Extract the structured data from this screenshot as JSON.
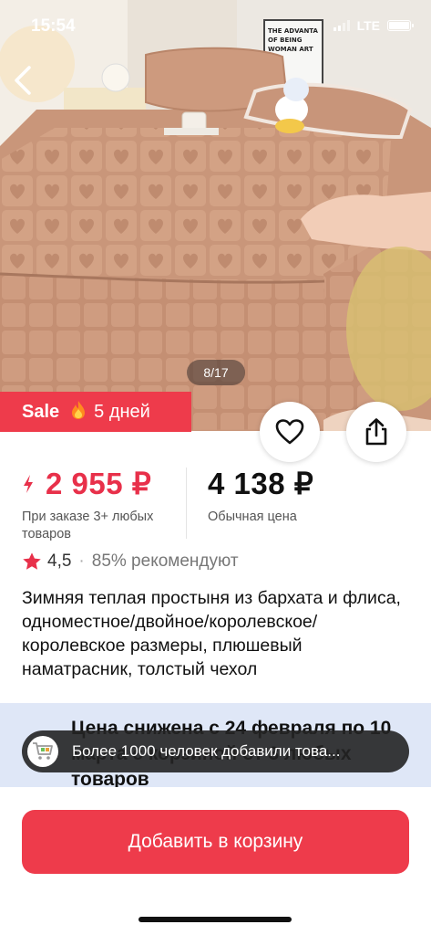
{
  "status_bar": {
    "time": "15:54",
    "network": "LTE"
  },
  "gallery": {
    "counter": "8/17",
    "poster_text": "THE ADVANTA OF BEING WOMAN ART"
  },
  "sale_badge": {
    "label": "Sale",
    "icon": "fire-icon",
    "days": "5 дней"
  },
  "price": {
    "sale_price": "2 955 ₽",
    "sale_note": "При заказе 3+ любых товаров",
    "regular_price": "4 138 ₽",
    "regular_note": "Обычная цена"
  },
  "rating": {
    "value": "4,5",
    "recommend": "85% рекомендуют"
  },
  "product": {
    "title": "Зимняя теплая простыня из бархата и флиса, одноместное/двойное/королевское/королевское размеры, плюшевый наматрасник, толстый чехол"
  },
  "promo": {
    "text": "Цена снижена с 24 февраля по 10 марта с корзиной от 3 любых товаров"
  },
  "toast": {
    "text": "Более 1000 человек добавили това..."
  },
  "cta": {
    "label": "Добавить в корзину"
  },
  "colors": {
    "accent": "#ee3b4b",
    "price_red": "#e8304a",
    "promo_bg": "#dfe7f7",
    "star": "#e8304a"
  }
}
